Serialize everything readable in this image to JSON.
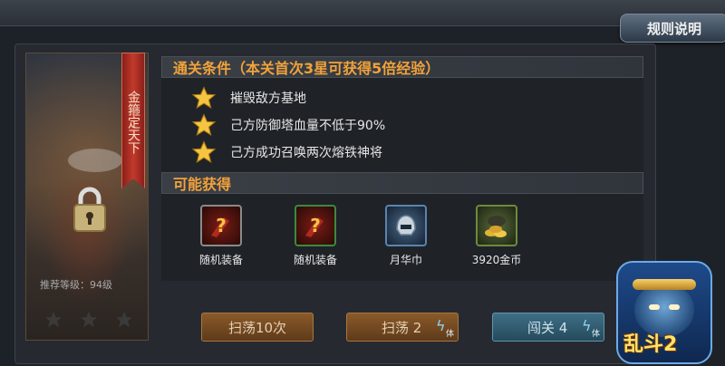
{
  "header": {
    "rules_label": "规则说明"
  },
  "stage_card": {
    "banner_text": "金箍定天下",
    "recommended_level": "推荐等级：94级",
    "stars_earned": 0,
    "stars_total": 3,
    "locked": true
  },
  "conditions": {
    "title": "通关条件（本关首次3星可获得5倍经验）",
    "items": [
      {
        "text": "摧毁敌方基地"
      },
      {
        "text": "己方防御塔血量不低于90%"
      },
      {
        "text": "己方成功召唤两次熔铁神将"
      }
    ]
  },
  "rewards": {
    "title": "可能获得",
    "items": [
      {
        "label": "随机装备",
        "icon": "random-equipment-icon"
      },
      {
        "label": "随机装备",
        "icon": "random-equipment-icon"
      },
      {
        "label": "月华巾",
        "icon": "helmet-icon"
      },
      {
        "label": "3920金币",
        "icon": "gold-coins-icon"
      }
    ]
  },
  "actions": {
    "sweep_10_label": "扫荡10次",
    "sweep_2_label": "扫荡 2",
    "challenge_label": "闯关 4",
    "stamina_label": "体"
  },
  "logo": {
    "text": "乱斗2"
  },
  "colors": {
    "accent_orange": "#f2a23a",
    "star_gold": "#f5c542"
  }
}
